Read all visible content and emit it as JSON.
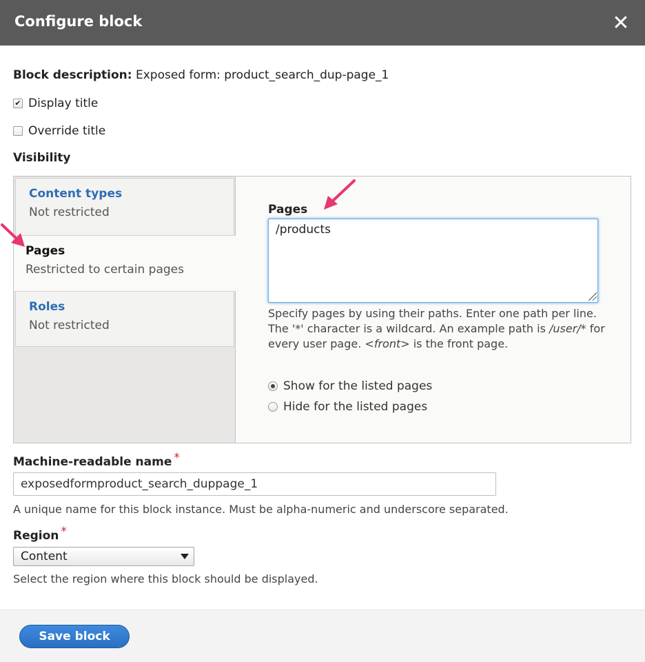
{
  "dialog": {
    "title": "Configure block"
  },
  "block": {
    "description_label": "Block description:",
    "description_value": "Exposed form: product_search_dup-page_1",
    "display_title_label": "Display title",
    "override_title_label": "Override title"
  },
  "visibility": {
    "label": "Visibility",
    "tabs": [
      {
        "title": "Content types",
        "summary": "Not restricted"
      },
      {
        "title": "Pages",
        "summary": "Restricted to certain pages"
      },
      {
        "title": "Roles",
        "summary": "Not restricted"
      }
    ],
    "pages_pane": {
      "label": "Pages",
      "textarea_value": "/products",
      "help_1": "Specify pages by using their paths. Enter one path per line. The '*' character is a wildcard. An example path is ",
      "help_path": "/user/*",
      "help_2": " for every user page. ",
      "help_front": "<front>",
      "help_3": " is the front page.",
      "radio_show": "Show for the listed pages",
      "radio_hide": "Hide for the listed pages"
    }
  },
  "machine_name": {
    "label": "Machine-readable name",
    "required_mark": "*",
    "value": "exposedformproduct_search_duppage_1",
    "description": "A unique name for this block instance. Must be alpha-numeric and underscore separated."
  },
  "region": {
    "label": "Region",
    "required_mark": "*",
    "selected": "Content",
    "description": "Select the region where this block should be displayed."
  },
  "actions": {
    "save_label": "Save block"
  },
  "colors": {
    "titlebar": "#5a5a5a",
    "link": "#2f6db3",
    "required": "#d0262f",
    "button": "#2a6fc2",
    "annotation_arrow": "#e8366f"
  }
}
